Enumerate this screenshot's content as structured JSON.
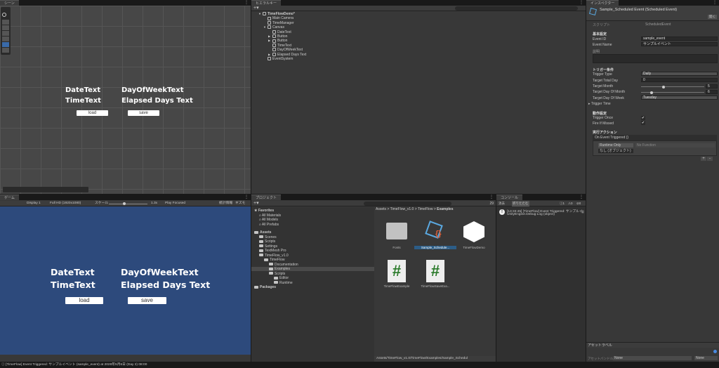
{
  "scene": {
    "tab": "シーン",
    "texts": {
      "date": "DateText",
      "time": "TimeText",
      "dow": "DayOfWeekText",
      "elapsed": "Elapsed Days Text"
    },
    "load": "load",
    "save": "save"
  },
  "game": {
    "tab": "ゲーム",
    "display": "Display 1",
    "resolution": "Full HD (1920x1080)",
    "scale_label": "スケール",
    "scale_value": "1.3x",
    "play_mode": "Play Focused",
    "stats": "統計情報",
    "gizmos": "ギズモ",
    "scale_fraction": 0.4,
    "texts": {
      "date": "DateText",
      "time": "TimeText",
      "dow": "DayOfWeekText",
      "elapsed": "Elapsed Days Text"
    },
    "load": "load",
    "save": "save",
    "bg_color": "#2d4a7c"
  },
  "hierarchy": {
    "tab": "ヒエラルキー",
    "items": [
      {
        "label": "TimeFlowDemo*",
        "depth": 0,
        "arrow": "▼",
        "bold": true
      },
      {
        "label": "Main Camera",
        "depth": 1,
        "arrow": ""
      },
      {
        "label": "TimeManager",
        "depth": 1,
        "arrow": ""
      },
      {
        "label": "Canvas",
        "depth": 1,
        "arrow": "▼"
      },
      {
        "label": "DateText",
        "depth": 2,
        "arrow": ""
      },
      {
        "label": "Button",
        "depth": 2,
        "arrow": "▶"
      },
      {
        "label": "Button",
        "depth": 2,
        "arrow": "▶"
      },
      {
        "label": "TimeText",
        "depth": 2,
        "arrow": ""
      },
      {
        "label": "DayOfWeekText",
        "depth": 2,
        "arrow": ""
      },
      {
        "label": "Elapsed Days Text",
        "depth": 2,
        "arrow": "▶"
      },
      {
        "label": "EventSystem",
        "depth": 1,
        "arrow": ""
      }
    ]
  },
  "inspector": {
    "tab": "インスペクター",
    "title": "Sample_Scheduled Event (Scheduled Event)",
    "open_button": "開く",
    "script_label": "スクリプト",
    "script_value": "ScheduledEvent",
    "basic_header": "基本設定",
    "event_id_label": "Event ID",
    "event_id": "sample_event",
    "event_name_label": "Event Name",
    "event_name": "サンプルイベント",
    "desc_label": "説明",
    "trigger_header": "トリガー条件",
    "trigger_type_label": "Trigger Type",
    "trigger_type": "Daily",
    "total_day_label": "Target Total Day",
    "total_day": "0",
    "month_label": "Target Month",
    "month": "5",
    "month_fraction": 0.36,
    "dom_label": "Target Day Of Month",
    "dom": "6",
    "dom_fraction": 0.17,
    "dow_label": "Target Day Of Week",
    "dow": "Tuesday",
    "trigger_time": "Trigger Time",
    "action_header": "動作設定",
    "once_label": "Trigger Once",
    "once": true,
    "missed_label": "Fire If Missed",
    "missed": true,
    "exec_header": "実行アクション",
    "event_label": "On Event Triggered ()",
    "runtime": "Runtime Only",
    "function": "No Function",
    "object": "なし (オブジェクト)",
    "plus": "+",
    "minus": "-",
    "asset_label_header": "アセットラベル",
    "bundle_label": "アセットバンドル",
    "bundle1": "None",
    "bundle2": "None"
  },
  "project": {
    "tab": "プロジェクト",
    "count": "29",
    "breadcrumb": [
      "Assets",
      "TimeFlow_v1.0",
      "TimeFlow",
      "Examples"
    ],
    "tree": [
      {
        "label": "Favorites",
        "depth": 0,
        "type": "star",
        "bold": true
      },
      {
        "label": "All Materials",
        "depth": 1,
        "type": "search"
      },
      {
        "label": "All Models",
        "depth": 1,
        "type": "search"
      },
      {
        "label": "All Prefabs",
        "depth": 1,
        "type": "search"
      },
      {
        "label": "Assets",
        "depth": 0,
        "type": "folder",
        "bold": true
      },
      {
        "label": "Scenes",
        "depth": 1,
        "type": "folder"
      },
      {
        "label": "Scripts",
        "depth": 1,
        "type": "folder"
      },
      {
        "label": "Settings",
        "depth": 1,
        "type": "folder"
      },
      {
        "label": "TextMesh Pro",
        "depth": 1,
        "type": "folder"
      },
      {
        "label": "TimeFlow_v1.0",
        "depth": 1,
        "type": "folder"
      },
      {
        "label": "TimeFlow",
        "depth": 2,
        "type": "folder"
      },
      {
        "label": "Documentation",
        "depth": 3,
        "type": "folder"
      },
      {
        "label": "Examples",
        "depth": 3,
        "type": "folder",
        "selected": true
      },
      {
        "label": "Scripts",
        "depth": 3,
        "type": "folder"
      },
      {
        "label": "Editor",
        "depth": 4,
        "type": "folder"
      },
      {
        "label": "Runtime",
        "depth": 4,
        "type": "folder"
      },
      {
        "label": "Packages",
        "depth": 0,
        "type": "folder",
        "bold": true
      }
    ],
    "assets": [
      {
        "label": "Fonts",
        "kind": "folder"
      },
      {
        "label": "Sample_Schedule...",
        "kind": "scriptable",
        "selected": true
      },
      {
        "label": "TimeFlowDemo",
        "kind": "unity"
      },
      {
        "label": "TimeFlowExample",
        "kind": "cs"
      },
      {
        "label": "TimeFlowSaveExa...",
        "kind": "cs"
      }
    ],
    "path": "Assets/TimeFlow_v1.0/TimeFlow/Examples/Sample_Schedul"
  },
  "console": {
    "tab": "コンソール",
    "clear": "消去",
    "collapse": "折りたたむ",
    "info_count": "1",
    "warn_count": "0",
    "error_count": "0",
    "entry_line1": "[13:33:45] [TimeFlow] Event Triggered: サンプルイ",
    "entry_line2": "UnityEngine.Debug:Log (object)",
    "entry_count": "1"
  },
  "status": {
    "message": "[TimeFlow] Event Triggered: サンプルイベント (sample_event) at 2028年5月6日 (Day 2) 08:00"
  }
}
